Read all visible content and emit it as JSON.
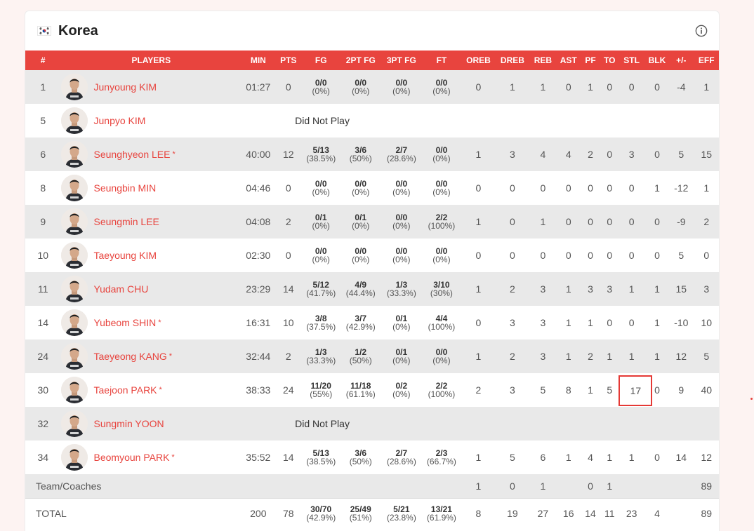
{
  "team": {
    "name": "Korea",
    "flag_icon": "south-korea-flag-icon",
    "info_icon": "info-icon"
  },
  "headers": [
    "#",
    "PLAYERS",
    "MIN",
    "PTS",
    "FG",
    "2PT FG",
    "3PT FG",
    "FT",
    "OREB",
    "DREB",
    "REB",
    "AST",
    "PF",
    "TO",
    "STL",
    "BLK",
    "+/-",
    "EFF"
  ],
  "players": [
    {
      "num": "1",
      "name": "Junyoung KIM",
      "starter": false,
      "dnp": false,
      "min": "01:27",
      "pts": "0",
      "fg": [
        "0/0",
        "(0%)"
      ],
      "fg2": [
        "0/0",
        "(0%)"
      ],
      "fg3": [
        "0/0",
        "(0%)"
      ],
      "ft": [
        "0/0",
        "(0%)"
      ],
      "oreb": "0",
      "dreb": "1",
      "reb": "1",
      "ast": "0",
      "pf": "1",
      "to": "0",
      "stl": "0",
      "blk": "0",
      "pm": "-4",
      "eff": "1"
    },
    {
      "num": "5",
      "name": "Junpyo KIM",
      "starter": false,
      "dnp": true,
      "dnp_label": "Did Not Play"
    },
    {
      "num": "6",
      "name": "Seunghyeon LEE",
      "starter": true,
      "dnp": false,
      "min": "40:00",
      "pts": "12",
      "fg": [
        "5/13",
        "(38.5%)"
      ],
      "fg2": [
        "3/6",
        "(50%)"
      ],
      "fg3": [
        "2/7",
        "(28.6%)"
      ],
      "ft": [
        "0/0",
        "(0%)"
      ],
      "oreb": "1",
      "dreb": "3",
      "reb": "4",
      "ast": "4",
      "pf": "2",
      "to": "0",
      "stl": "3",
      "blk": "0",
      "pm": "5",
      "eff": "15"
    },
    {
      "num": "8",
      "name": "Seungbin MIN",
      "starter": false,
      "dnp": false,
      "min": "04:46",
      "pts": "0",
      "fg": [
        "0/0",
        "(0%)"
      ],
      "fg2": [
        "0/0",
        "(0%)"
      ],
      "fg3": [
        "0/0",
        "(0%)"
      ],
      "ft": [
        "0/0",
        "(0%)"
      ],
      "oreb": "0",
      "dreb": "0",
      "reb": "0",
      "ast": "0",
      "pf": "0",
      "to": "0",
      "stl": "0",
      "blk": "1",
      "pm": "-12",
      "eff": "1"
    },
    {
      "num": "9",
      "name": "Seungmin LEE",
      "starter": false,
      "dnp": false,
      "min": "04:08",
      "pts": "2",
      "fg": [
        "0/1",
        "(0%)"
      ],
      "fg2": [
        "0/1",
        "(0%)"
      ],
      "fg3": [
        "0/0",
        "(0%)"
      ],
      "ft": [
        "2/2",
        "(100%)"
      ],
      "oreb": "1",
      "dreb": "0",
      "reb": "1",
      "ast": "0",
      "pf": "0",
      "to": "0",
      "stl": "0",
      "blk": "0",
      "pm": "-9",
      "eff": "2"
    },
    {
      "num": "10",
      "name": "Taeyoung KIM",
      "starter": false,
      "dnp": false,
      "min": "02:30",
      "pts": "0",
      "fg": [
        "0/0",
        "(0%)"
      ],
      "fg2": [
        "0/0",
        "(0%)"
      ],
      "fg3": [
        "0/0",
        "(0%)"
      ],
      "ft": [
        "0/0",
        "(0%)"
      ],
      "oreb": "0",
      "dreb": "0",
      "reb": "0",
      "ast": "0",
      "pf": "0",
      "to": "0",
      "stl": "0",
      "blk": "0",
      "pm": "5",
      "eff": "0"
    },
    {
      "num": "11",
      "name": "Yudam CHU",
      "starter": false,
      "dnp": false,
      "min": "23:29",
      "pts": "14",
      "fg": [
        "5/12",
        "(41.7%)"
      ],
      "fg2": [
        "4/9",
        "(44.4%)"
      ],
      "fg3": [
        "1/3",
        "(33.3%)"
      ],
      "ft": [
        "3/10",
        "(30%)"
      ],
      "oreb": "1",
      "dreb": "2",
      "reb": "3",
      "ast": "1",
      "pf": "3",
      "to": "3",
      "stl": "1",
      "blk": "1",
      "pm": "15",
      "eff": "3"
    },
    {
      "num": "14",
      "name": "Yubeom SHIN",
      "starter": true,
      "dnp": false,
      "min": "16:31",
      "pts": "10",
      "fg": [
        "3/8",
        "(37.5%)"
      ],
      "fg2": [
        "3/7",
        "(42.9%)"
      ],
      "fg3": [
        "0/1",
        "(0%)"
      ],
      "ft": [
        "4/4",
        "(100%)"
      ],
      "oreb": "0",
      "dreb": "3",
      "reb": "3",
      "ast": "1",
      "pf": "1",
      "to": "0",
      "stl": "0",
      "blk": "1",
      "pm": "-10",
      "eff": "10"
    },
    {
      "num": "24",
      "name": "Taeyeong KANG",
      "starter": true,
      "dnp": false,
      "min": "32:44",
      "pts": "2",
      "fg": [
        "1/3",
        "(33.3%)"
      ],
      "fg2": [
        "1/2",
        "(50%)"
      ],
      "fg3": [
        "0/1",
        "(0%)"
      ],
      "ft": [
        "0/0",
        "(0%)"
      ],
      "oreb": "1",
      "dreb": "2",
      "reb": "3",
      "ast": "1",
      "pf": "2",
      "to": "1",
      "stl": "1",
      "blk": "1",
      "pm": "12",
      "eff": "5"
    },
    {
      "num": "30",
      "name": "Taejoon PARK",
      "starter": true,
      "dnp": false,
      "min": "38:33",
      "pts": "24",
      "fg": [
        "11/20",
        "(55%)"
      ],
      "fg2": [
        "11/18",
        "(61.1%)"
      ],
      "fg3": [
        "0/2",
        "(0%)"
      ],
      "ft": [
        "2/2",
        "(100%)"
      ],
      "oreb": "2",
      "dreb": "3",
      "reb": "5",
      "ast": "8",
      "pf": "1",
      "to": "5",
      "stl": "17",
      "blk": "0",
      "pm": "9",
      "eff": "40",
      "highlight_stl": true
    },
    {
      "num": "32",
      "name": "Sungmin YOON",
      "starter": false,
      "dnp": true,
      "dnp_label": "Did Not Play"
    },
    {
      "num": "34",
      "name": "Beomyoun PARK",
      "starter": true,
      "dnp": false,
      "min": "35:52",
      "pts": "14",
      "fg": [
        "5/13",
        "(38.5%)"
      ],
      "fg2": [
        "3/6",
        "(50%)"
      ],
      "fg3": [
        "2/7",
        "(28.6%)"
      ],
      "ft": [
        "2/3",
        "(66.7%)"
      ],
      "oreb": "1",
      "dreb": "5",
      "reb": "6",
      "ast": "1",
      "pf": "4",
      "to": "1",
      "stl": "1",
      "blk": "0",
      "pm": "14",
      "eff": "12"
    }
  ],
  "team_row": {
    "label": "Team/Coaches",
    "oreb": "1",
    "dreb": "0",
    "reb": "1",
    "pf": "0",
    "to": "1",
    "eff": "89"
  },
  "total_row": {
    "label": "TOTAL",
    "min": "200",
    "pts": "78",
    "fg": [
      "30/70",
      "(42.9%)"
    ],
    "fg2": [
      "25/49",
      "(51%)"
    ],
    "fg3": [
      "5/21",
      "(23.8%)"
    ],
    "ft": [
      "13/21",
      "(61.9%)"
    ],
    "oreb": "8",
    "dreb": "19",
    "reb": "27",
    "ast": "16",
    "pf": "14",
    "to": "11",
    "stl": "23",
    "blk": "4",
    "eff": "89"
  },
  "colors": {
    "accent": "#e8443e",
    "highlight_box": "#e53935",
    "row_shade": "#e9e9e9"
  }
}
